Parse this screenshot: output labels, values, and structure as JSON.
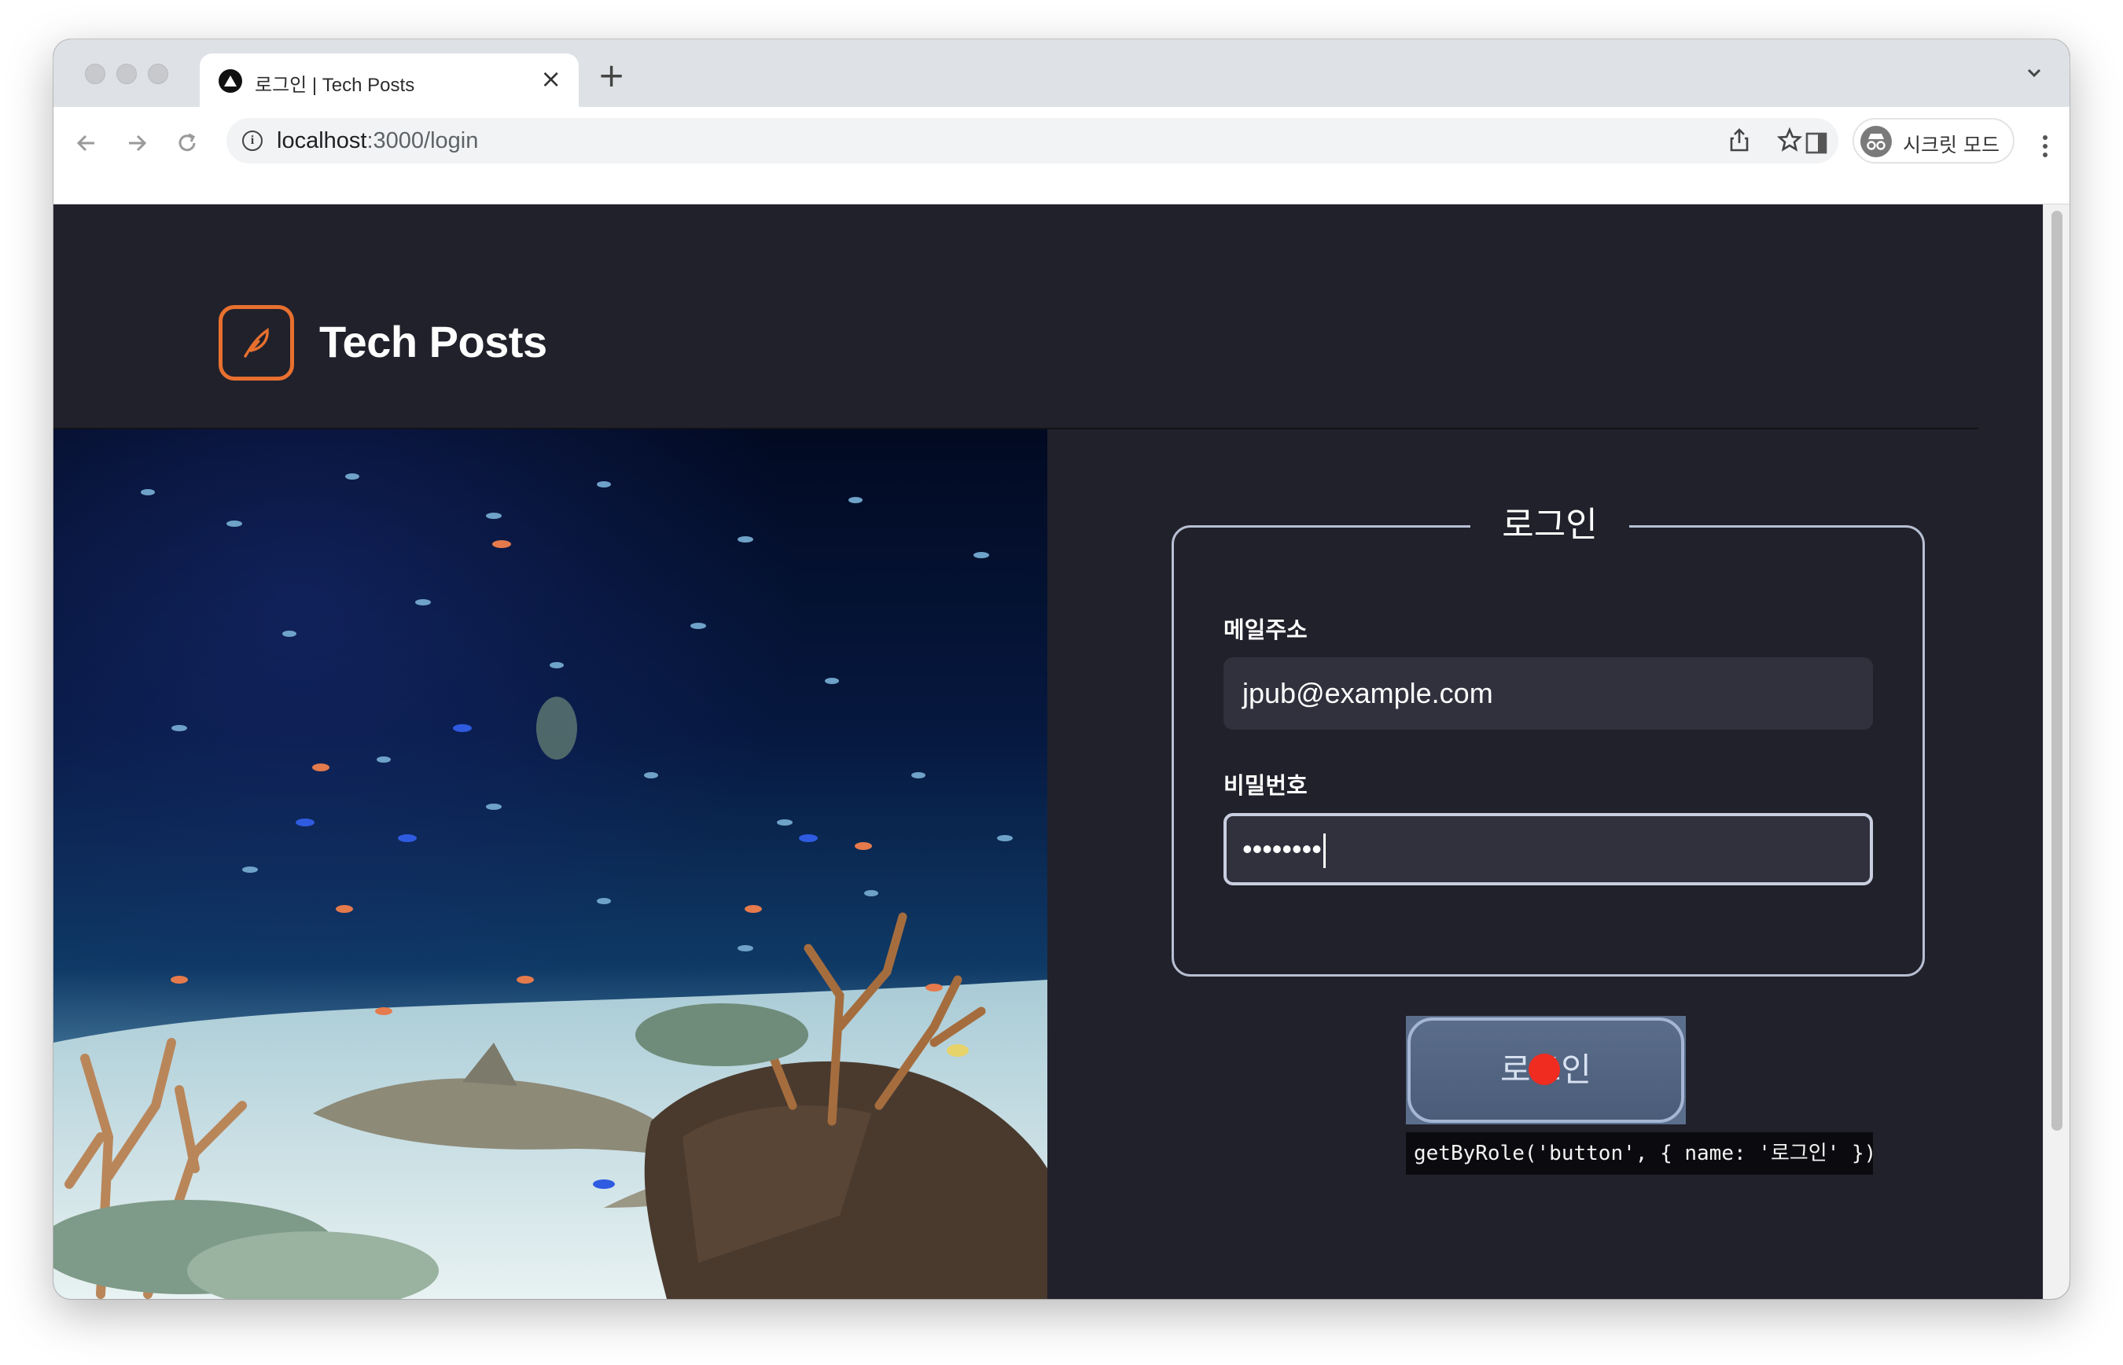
{
  "browser": {
    "tab_title": "로그인 | Tech Posts",
    "tab_close": "×",
    "new_tab": "+",
    "url_host": "localhost",
    "url_path": ":3000/login",
    "profile_label": "시크릿 모드",
    "icons": [
      "back-icon",
      "forward-icon",
      "reload-icon",
      "info-icon",
      "share-icon",
      "star-icon",
      "side-panel-icon",
      "incognito-icon",
      "kebab-menu-icon",
      "tab-menu-icon"
    ]
  },
  "app": {
    "brand": "Tech Posts",
    "logo_icon": "feather-icon",
    "accent": "#e8702f",
    "background": "#21212b"
  },
  "login": {
    "legend": "로그인",
    "email_label": "메일주소",
    "email_value": "jpub@example.com",
    "password_label": "비밀번호",
    "password_value": "••••••••",
    "submit_label": "로그인",
    "locator_tooltip": "getByRole('button', { name: '로그인' })"
  },
  "hero": {
    "icon": "aquarium-photo"
  }
}
